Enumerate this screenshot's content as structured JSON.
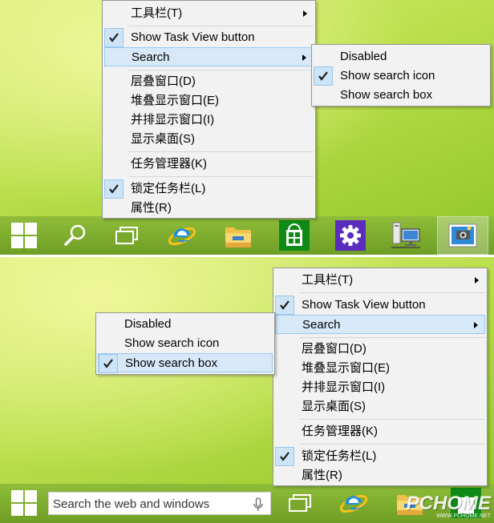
{
  "context_menu": {
    "toolbars": "工具栏(T)",
    "show_task_view_button": "Show Task View button",
    "search": "Search",
    "cascade_windows": "层叠窗口(D)",
    "stack_windows": "堆叠显示窗口(E)",
    "side_by_side_windows": "并排显示窗口(I)",
    "show_desktop": "显示桌面(S)",
    "task_manager": "任务管理器(K)",
    "lock_taskbar": "锁定任务栏(L)",
    "properties": "属性(R)"
  },
  "search_submenu": {
    "disabled": "Disabled",
    "show_search_icon": "Show search icon",
    "show_search_box": "Show search box"
  },
  "taskbar_bottom": {
    "search_placeholder": "Search the web and windows"
  },
  "watermark": {
    "main": "PCHOME",
    "sub": "WWW.PCHOME.NET"
  },
  "icons": [
    "windows-start-icon",
    "search-icon",
    "task-view-icon",
    "internet-explorer-icon",
    "file-explorer-icon",
    "store-icon",
    "settings-gear-icon",
    "network-computer-icon",
    "photo-app-icon",
    "microphone-icon",
    "checkmark-icon",
    "submenu-arrow-icon"
  ],
  "colors": {
    "menu_background": "#f2f2f2",
    "menu_highlight": "#d7e9f8",
    "check_background": "#cde4f7",
    "taskbar": "#7aa82c",
    "store_green": "#0e8a16",
    "settings_purple": "#5a2dbf"
  }
}
